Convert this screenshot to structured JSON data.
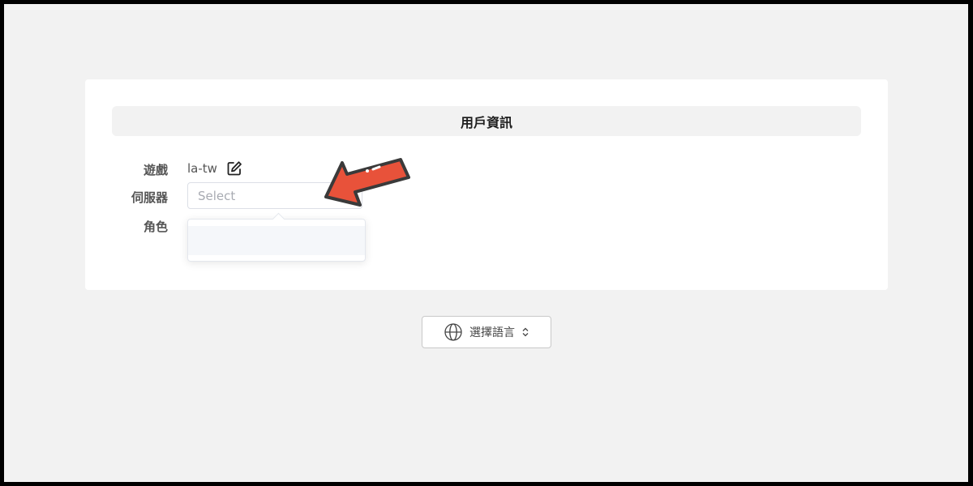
{
  "card": {
    "title": "用戶資訊"
  },
  "form": {
    "game_label": "遊戲",
    "game_value": "la-tw",
    "server_label": "伺服器",
    "server_placeholder": "Select",
    "role_label": "角色"
  },
  "language": {
    "label": "選擇語言"
  },
  "icons": {
    "edit": "edit-icon",
    "globe": "globe-icon",
    "sort": "chevron-up-down-icon",
    "pointer": "pointer-arrow-icon"
  },
  "colors": {
    "page_background": "#f2f2f2",
    "card_background": "#ffffff",
    "header_background": "#f2f2f2",
    "arrow_fill": "#e8523a",
    "arrow_outline": "#3a3a3a"
  }
}
